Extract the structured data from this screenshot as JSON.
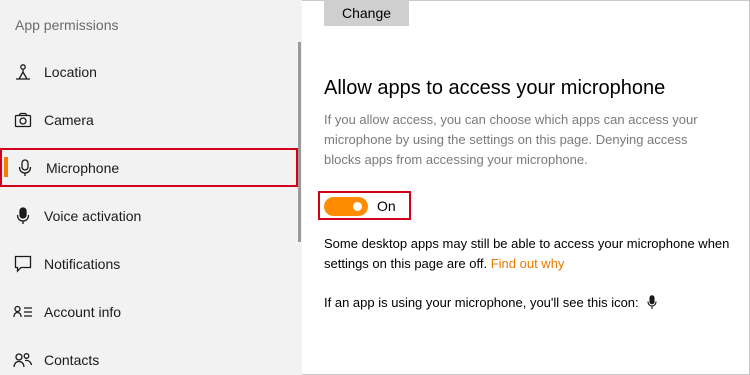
{
  "sidebar": {
    "header": "App permissions",
    "items": [
      {
        "label": "Location",
        "icon": "location-icon"
      },
      {
        "label": "Camera",
        "icon": "camera-icon"
      },
      {
        "label": "Microphone",
        "icon": "microphone-icon",
        "selected": true
      },
      {
        "label": "Voice activation",
        "icon": "voice-activation-icon"
      },
      {
        "label": "Notifications",
        "icon": "notifications-icon"
      },
      {
        "label": "Account info",
        "icon": "account-info-icon"
      },
      {
        "label": "Contacts",
        "icon": "contacts-icon"
      }
    ]
  },
  "main": {
    "change_button": "Change",
    "heading": "Allow apps to access your microphone",
    "description": "If you allow access, you can choose which apps can access your microphone by using the settings on this page. Denying access blocks apps from accessing your microphone.",
    "toggle": {
      "state_label": "On",
      "on": true
    },
    "note_text": "Some desktop apps may still be able to access your microphone when settings on this page are off.",
    "note_link": "Find out why",
    "icon_line": "If an app is using your microphone, you'll see this icon:"
  },
  "colors": {
    "accent": "#ff8c00",
    "link": "#e57b00",
    "highlight_border": "#d0021b",
    "sidebar_bg": "#f2f2f2"
  }
}
